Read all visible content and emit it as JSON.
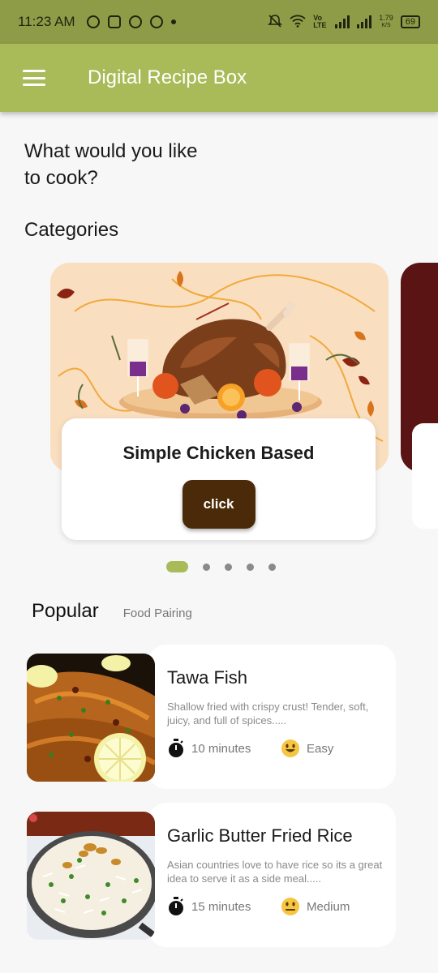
{
  "status": {
    "time": "11:23 AM",
    "net_label": "Vo LTE",
    "speed": "1.79",
    "speed_unit": "K/S",
    "battery": "69"
  },
  "app_bar": {
    "title": "Digital Recipe Box"
  },
  "headline": "What would you like to cook?",
  "categories": {
    "title": "Categories",
    "current": {
      "name": "Simple Chicken Based",
      "button": "click"
    },
    "dots": 5,
    "active_dot": 0
  },
  "tabs": {
    "popular": "Popular",
    "food_pairing": "Food Pairing"
  },
  "recipes": [
    {
      "title": "Tawa Fish",
      "description": "Shallow fried with crispy crust! Tender, soft, juicy, and full of spices.....",
      "time": "10 minutes",
      "difficulty": "Easy",
      "difficulty_icon": "smiling-face-icon"
    },
    {
      "title": "Garlic Butter Fried Rice",
      "description": "Asian countries love to have rice so its a great idea to serve it as a side meal.....",
      "time": "15 minutes",
      "difficulty": "Medium",
      "difficulty_icon": "neutral-face-icon"
    }
  ],
  "colors": {
    "status_bar": "#8f9c47",
    "app_bar": "#a9bb58",
    "button": "#4a2a08",
    "active_dot": "#a9bb58"
  }
}
